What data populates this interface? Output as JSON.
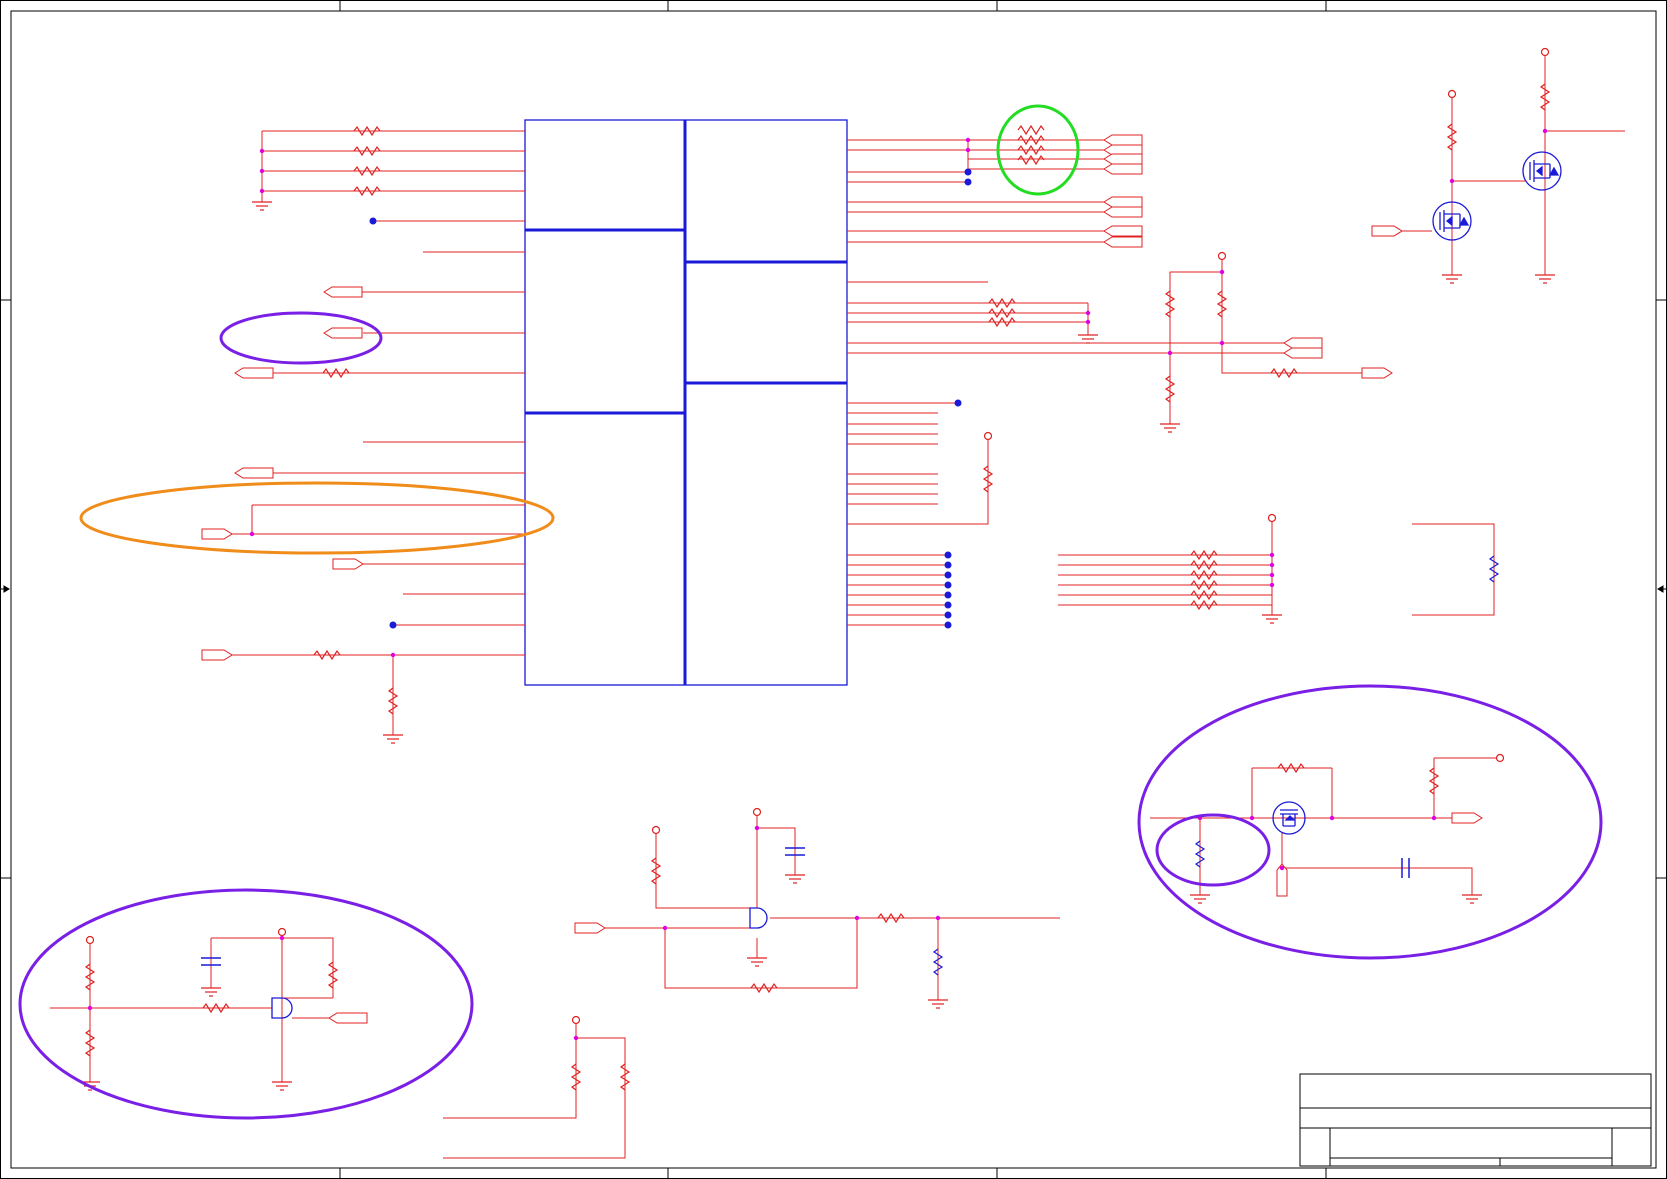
{
  "colors": {
    "background": "#ffffff",
    "frame": "#000000",
    "wire": "#e02020",
    "component": "#1a1ad8",
    "junction": "#e000e0",
    "highlight_green": "#22dd22",
    "highlight_orange": "#f08c1a",
    "highlight_purple": "#7a1fe6"
  },
  "icons": [
    "resistor-icon",
    "capacitor-icon",
    "ground-icon",
    "mosfet-icon",
    "and-gate-icon",
    "port-icon",
    "power-pin-icon"
  ]
}
